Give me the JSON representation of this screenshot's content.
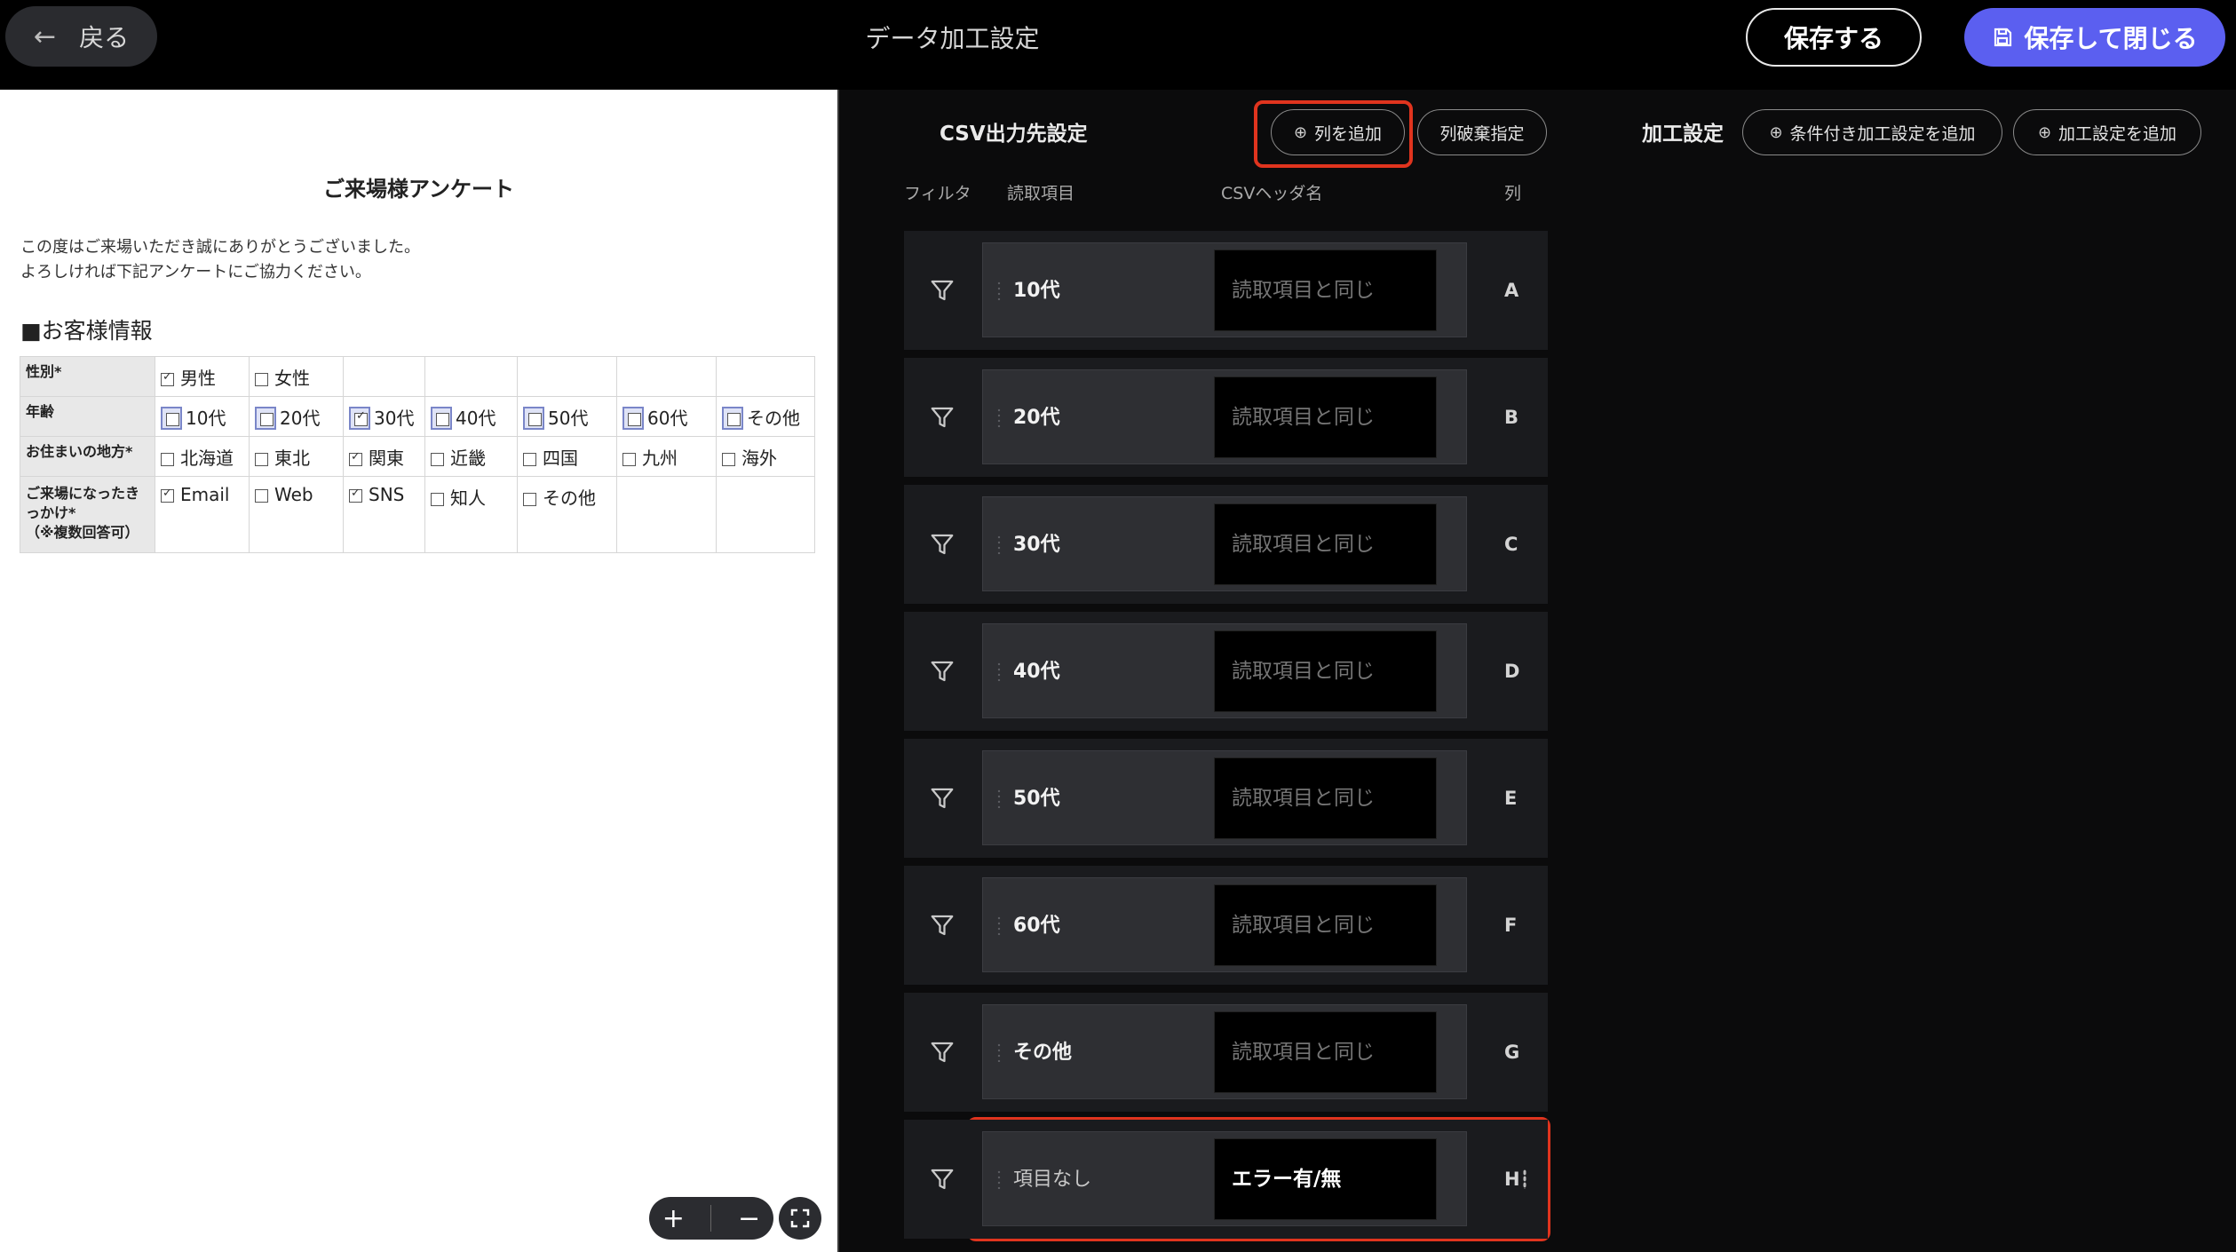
{
  "header": {
    "back_label": "戻る",
    "title": "データ加工設定",
    "save_label": "保存する",
    "save_close_label": "保存して閉じる"
  },
  "document": {
    "title": "ご来場様アンケート",
    "intro_line1": "この度はご来場いただき誠にありがとうございました。",
    "intro_line2": "よろしければ下記アンケートにご協力ください。",
    "section": "■お客様情報",
    "rows": {
      "gender": {
        "label": "性別*",
        "options": [
          "男性",
          "女性"
        ]
      },
      "age": {
        "label": "年齢",
        "options": [
          "10代",
          "20代",
          "30代",
          "40代",
          "50代",
          "60代",
          "その他"
        ]
      },
      "region": {
        "label": "お住まいの地方*",
        "options": [
          "北海道",
          "東北",
          "関東",
          "近畿",
          "四国",
          "九州",
          "海外"
        ]
      },
      "trigger": {
        "label_line1": "ご来場になったき",
        "label_line2": "っかけ*",
        "label_line3": "（※複数回答可）",
        "options": [
          "Email",
          "Web",
          "SNS",
          "知人",
          "その他"
        ]
      }
    }
  },
  "zoom": {
    "plus": "+",
    "minus": "−"
  },
  "csv": {
    "title": "CSV出力先設定",
    "add_column_label": "列を追加",
    "discard_column_label": "列破棄指定",
    "headers": {
      "filter": "フィルタ",
      "read_item": "読取項目",
      "csv_header": "CSVヘッダ名",
      "column": "列"
    },
    "rows": [
      {
        "item": "10代",
        "placeholder": "読取項目と同じ",
        "value": "",
        "column": "A"
      },
      {
        "item": "20代",
        "placeholder": "読取項目と同じ",
        "value": "",
        "column": "B"
      },
      {
        "item": "30代",
        "placeholder": "読取項目と同じ",
        "value": "",
        "column": "C"
      },
      {
        "item": "40代",
        "placeholder": "読取項目と同じ",
        "value": "",
        "column": "D"
      },
      {
        "item": "50代",
        "placeholder": "読取項目と同じ",
        "value": "",
        "column": "E"
      },
      {
        "item": "60代",
        "placeholder": "読取項目と同じ",
        "value": "",
        "column": "F"
      },
      {
        "item": "その他",
        "placeholder": "読取項目と同じ",
        "value": "",
        "column": "G"
      },
      {
        "item": "項目なし",
        "placeholder": "",
        "value": "エラー有/無",
        "column": "H"
      }
    ]
  },
  "processing": {
    "title": "加工設定",
    "add_conditional_label": "条件付き加工設定を追加",
    "add_label": "加工設定を追加"
  },
  "colors": {
    "accent": "#5b5ff0",
    "highlight_border": "#e0341e"
  }
}
